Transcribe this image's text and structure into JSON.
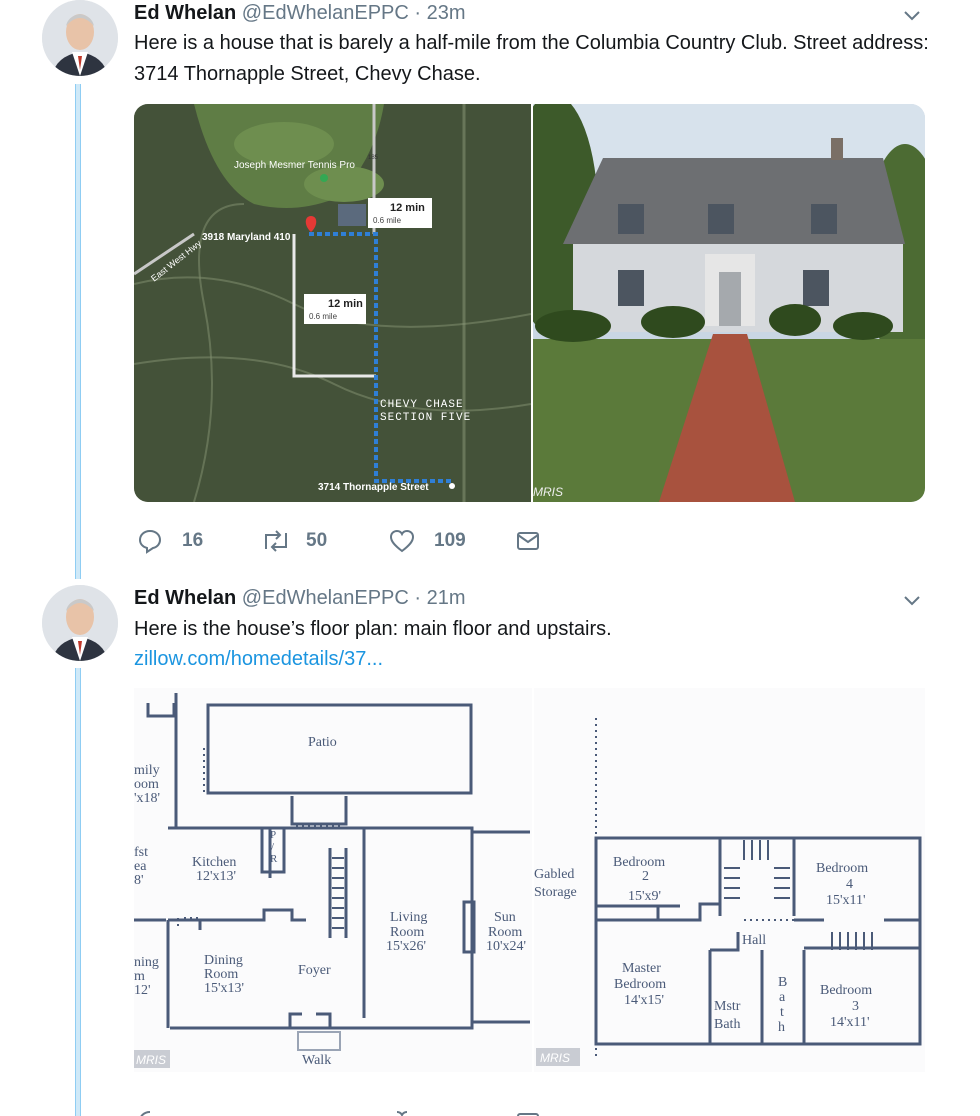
{
  "tweets": [
    {
      "name": "Ed Whelan",
      "handle": "@EdWhelanEPPC",
      "sep": "·",
      "time": "23m",
      "text": "Here is a house that is barely a half-mile from the Columbia Country Club. Street address: 3714 Thornapple Street, Chevy Chase.",
      "map": {
        "places": [
          "Joseph Mesmer Tennis Pro",
          "3918 Maryland 410",
          "East West Hwy",
          "CHEVY CHASE",
          "SECTION FIVE",
          "3714 Thornapple Street"
        ],
        "route_a": {
          "time": "12 min",
          "dist": "0.6 mile"
        },
        "route_b": {
          "time": "12 min",
          "dist": "0.6 mile"
        },
        "road_num": "185"
      },
      "photo_watermark": "MRIS",
      "actions": {
        "replies": "16",
        "retweets": "50",
        "likes": "109"
      }
    },
    {
      "name": "Ed Whelan",
      "handle": "@EdWhelanEPPC",
      "sep": "·",
      "time": "21m",
      "text": "Here is the house’s floor plan: main floor and upstairs.",
      "link": "zillow.com/homedetails/37...",
      "plan_main": {
        "patio": "Patio",
        "family": [
          "mily",
          "oom",
          "'x18'"
        ],
        "breakfast": [
          "fst",
          "ea",
          "8'"
        ],
        "kitchen": [
          "Kitchen",
          "12'x13'"
        ],
        "pr": [
          "P",
          "/",
          "R"
        ],
        "living": [
          "Living",
          "Room",
          "15'x26'"
        ],
        "sun": [
          "Sun",
          "Room",
          "10'x24'"
        ],
        "dining_cut": [
          "ning",
          "m",
          "12'"
        ],
        "dining": [
          "Dining",
          "Room",
          "15'x13'"
        ],
        "foyer": "Foyer",
        "walk": "Walk",
        "watermark": "MRIS"
      },
      "plan_up": {
        "storage": [
          "Gabled",
          "Storage"
        ],
        "bed2": [
          "Bedroom",
          "2",
          "15'x9'"
        ],
        "bed4": [
          "Bedroom",
          "4",
          "15'x11'"
        ],
        "hall": "Hall",
        "master": [
          "Master",
          "Bedroom",
          "14'x15'"
        ],
        "mstr_bath": [
          "Mstr",
          "Bath"
        ],
        "bath": [
          "B",
          "a",
          "t",
          "h"
        ],
        "bed3": [
          "Bedroom",
          "3",
          "14'x11'"
        ],
        "watermark": "MRIS"
      }
    }
  ],
  "colors": {
    "link": "#1b95e0",
    "thread": "#8fcdf3",
    "muted": "#657786",
    "plan_line": "#4a5a78"
  }
}
